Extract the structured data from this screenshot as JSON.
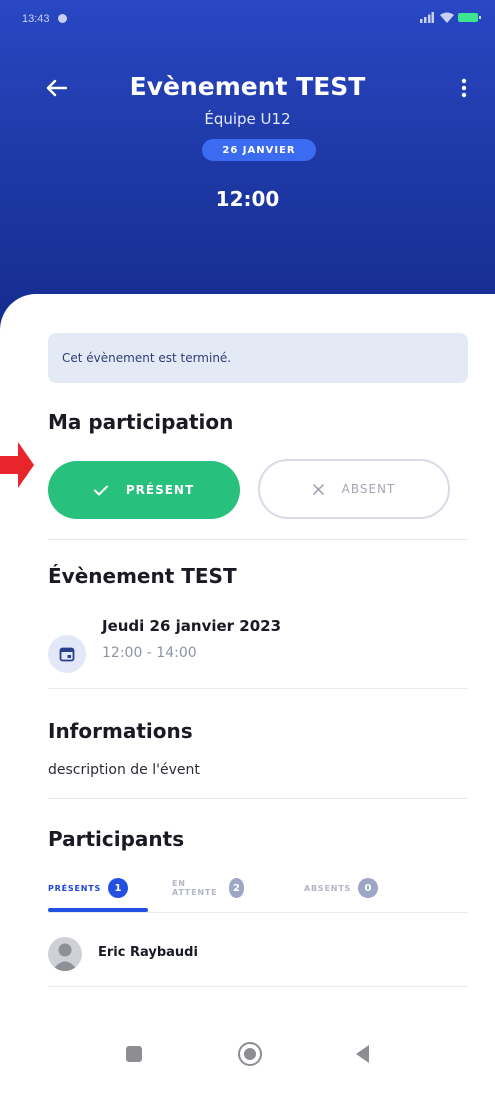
{
  "status_bar": {
    "time": "13:43",
    "icons": [
      "notification-dot-icon",
      "signal-icon",
      "wifi-icon",
      "battery-icon"
    ]
  },
  "header": {
    "title": "Evènement TEST",
    "team": "Équipe U12",
    "date_badge": "26 JANVIER",
    "time": "12:00",
    "back_icon": "arrow-left-icon",
    "menu_icon": "more-vertical-icon"
  },
  "notice": "Cet évènement est terminé.",
  "participation": {
    "title": "Ma participation",
    "present_label": "PRÉSENT",
    "absent_label": "ABSENT",
    "selected": "present"
  },
  "event": {
    "title": "Évènement TEST",
    "date": "Jeudi 26 janvier 2023",
    "hours": "12:00 - 14:00"
  },
  "informations": {
    "title": "Informations",
    "description": "description de l'évent"
  },
  "participants": {
    "title": "Participants",
    "tabs": [
      {
        "label": "PRÉSENTS",
        "count": "1",
        "active": true
      },
      {
        "label": "EN ATTENTE",
        "count": "2",
        "active": false
      },
      {
        "label": "ABSENTS",
        "count": "0",
        "active": false
      }
    ],
    "list": [
      {
        "name": "Eric Raybaudi"
      }
    ]
  },
  "nav_bar": {
    "icons": [
      "recents-square-icon",
      "home-circle-icon",
      "back-triangle-icon"
    ]
  },
  "colors": {
    "header_blue": "#1f3aa8",
    "date_pill": "#3a6bf0",
    "present_green": "#27c07d",
    "tab_active_blue": "#2250e0",
    "notice_bg": "#e4e9f6",
    "annotation_arrow": "#e8252a"
  }
}
